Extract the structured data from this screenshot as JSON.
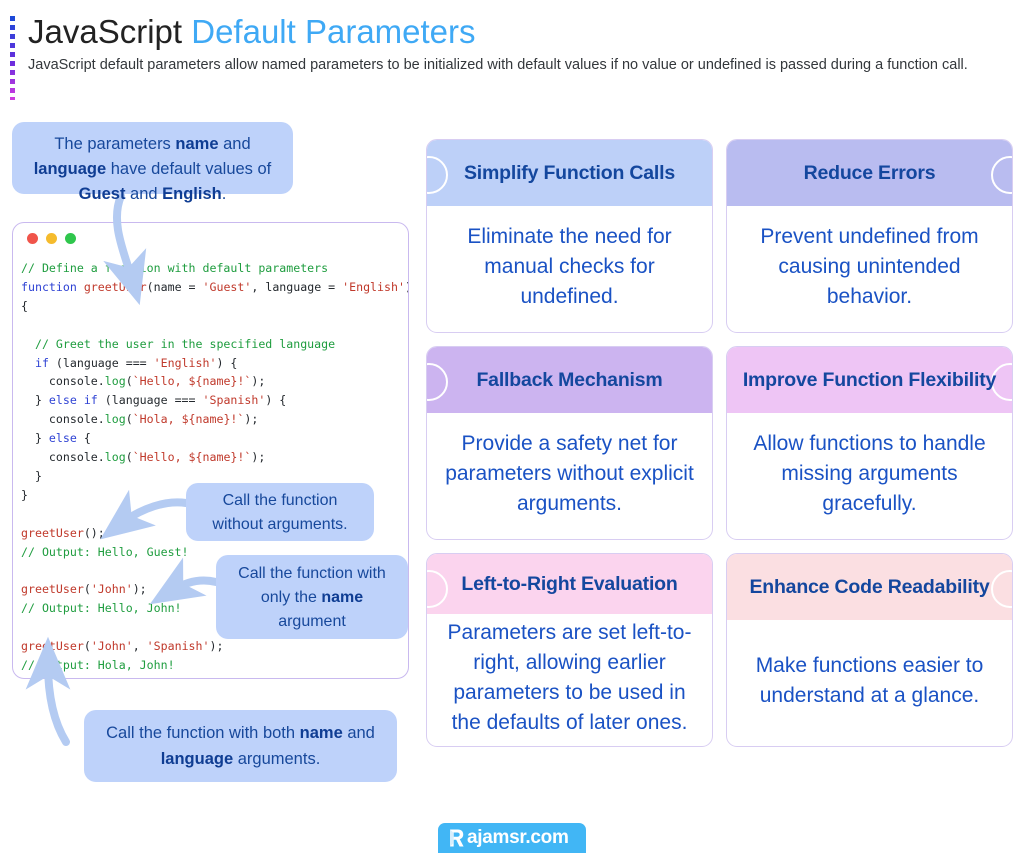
{
  "header": {
    "title_plain": "JavaScript",
    "title_accent": "Default Parameters",
    "subtitle": "JavaScript default parameters allow named parameters to be initialized with default values if no value or undefined is passed during a function call."
  },
  "callouts": {
    "top": {
      "segments": [
        {
          "text": "The parameters ",
          "bold": false
        },
        {
          "text": "name",
          "bold": true
        },
        {
          "text": " and ",
          "bold": false
        },
        {
          "text": "language",
          "bold": true
        },
        {
          "text": " have default values of ",
          "bold": false
        },
        {
          "text": "Guest",
          "bold": true
        },
        {
          "text": " and ",
          "bold": false
        },
        {
          "text": "English",
          "bold": true
        },
        {
          "text": ".",
          "bold": false
        }
      ]
    },
    "no_args": {
      "segments": [
        {
          "text": "Call the function without arguments.",
          "bold": false
        }
      ]
    },
    "name_arg": {
      "segments": [
        {
          "text": "Call the function with only the ",
          "bold": false
        },
        {
          "text": "name",
          "bold": true
        },
        {
          "text": " argument",
          "bold": false
        }
      ]
    },
    "both_args": {
      "segments": [
        {
          "text": "Call the function with both ",
          "bold": false
        },
        {
          "text": "name",
          "bold": true
        },
        {
          "text": " and ",
          "bold": false
        },
        {
          "text": "language",
          "bold": true
        },
        {
          "text": " arguments.",
          "bold": false
        }
      ]
    }
  },
  "code_window": {
    "dots": [
      "red",
      "yellow",
      "green"
    ],
    "lines": [
      [
        {
          "t": "// Define a function with default parameters",
          "c": "cm"
        }
      ],
      [
        {
          "t": "function ",
          "c": "kw"
        },
        {
          "t": "greetUser",
          "c": "fn"
        },
        {
          "t": "(name = ",
          "c": "pl"
        },
        {
          "t": "'Guest'",
          "c": "st"
        },
        {
          "t": ", language = ",
          "c": "pl"
        },
        {
          "t": "'English'",
          "c": "st"
        },
        {
          "t": ")",
          "c": "pl"
        }
      ],
      [
        {
          "t": "{",
          "c": "pl"
        }
      ],
      [
        {
          "t": "",
          "c": "pl"
        }
      ],
      [
        {
          "t": "  // Greet the user in the specified language",
          "c": "cm"
        }
      ],
      [
        {
          "t": "  ",
          "c": "pl"
        },
        {
          "t": "if",
          "c": "kw"
        },
        {
          "t": " (language === ",
          "c": "pl"
        },
        {
          "t": "'English'",
          "c": "st"
        },
        {
          "t": ") {",
          "c": "pl"
        }
      ],
      [
        {
          "t": "    console.",
          "c": "pl"
        },
        {
          "t": "log",
          "c": "mth"
        },
        {
          "t": "(",
          "c": "pl"
        },
        {
          "t": "`Hello, ${name}!`",
          "c": "st"
        },
        {
          "t": ");",
          "c": "pl"
        }
      ],
      [
        {
          "t": "  } ",
          "c": "pl"
        },
        {
          "t": "else if",
          "c": "kw"
        },
        {
          "t": " (language === ",
          "c": "pl"
        },
        {
          "t": "'Spanish'",
          "c": "st"
        },
        {
          "t": ") {",
          "c": "pl"
        }
      ],
      [
        {
          "t": "    console.",
          "c": "pl"
        },
        {
          "t": "log",
          "c": "mth"
        },
        {
          "t": "(",
          "c": "pl"
        },
        {
          "t": "`Hola, ${name}!`",
          "c": "st"
        },
        {
          "t": ");",
          "c": "pl"
        }
      ],
      [
        {
          "t": "  } ",
          "c": "pl"
        },
        {
          "t": "else",
          "c": "kw"
        },
        {
          "t": " {",
          "c": "pl"
        }
      ],
      [
        {
          "t": "    console.",
          "c": "pl"
        },
        {
          "t": "log",
          "c": "mth"
        },
        {
          "t": "(",
          "c": "pl"
        },
        {
          "t": "`Hello, ${name}!`",
          "c": "st"
        },
        {
          "t": ");",
          "c": "pl"
        }
      ],
      [
        {
          "t": "  }",
          "c": "pl"
        }
      ],
      [
        {
          "t": "}",
          "c": "pl"
        }
      ],
      [
        {
          "t": "",
          "c": "pl"
        }
      ],
      [
        {
          "t": "greetUser",
          "c": "fn"
        },
        {
          "t": "();",
          "c": "pl"
        }
      ],
      [
        {
          "t": "// Output: Hello, Guest!",
          "c": "cm"
        }
      ],
      [
        {
          "t": "",
          "c": "pl"
        }
      ],
      [
        {
          "t": "greetUser",
          "c": "fn"
        },
        {
          "t": "(",
          "c": "pl"
        },
        {
          "t": "'John'",
          "c": "st"
        },
        {
          "t": ");",
          "c": "pl"
        }
      ],
      [
        {
          "t": "// Output: Hello, John!",
          "c": "cm"
        }
      ],
      [
        {
          "t": "",
          "c": "pl"
        }
      ],
      [
        {
          "t": "greetUser",
          "c": "fn"
        },
        {
          "t": "(",
          "c": "pl"
        },
        {
          "t": "'John'",
          "c": "st"
        },
        {
          "t": ", ",
          "c": "pl"
        },
        {
          "t": "'Spanish'",
          "c": "st"
        },
        {
          "t": ");",
          "c": "pl"
        }
      ],
      [
        {
          "t": "// Output: Hola, John!",
          "c": "cm"
        }
      ]
    ]
  },
  "cards": [
    {
      "title": "Simplify Function Calls",
      "text": "Eliminate the need for manual checks for undefined.",
      "header_color": "#bdd0f8",
      "circle_side": "left"
    },
    {
      "title": "Reduce Errors",
      "text": "Prevent undefined from causing unintended behavior.",
      "header_color": "#b9bcf0",
      "circle_side": "right"
    },
    {
      "title": "Fallback Mechanism",
      "text": "Provide a safety net for parameters without explicit arguments.",
      "header_color": "#ccb4f0",
      "circle_side": "left"
    },
    {
      "title": "Improve Function Flexibility",
      "text": "Allow functions to handle missing arguments gracefully.",
      "header_color": "#eec5f5",
      "circle_side": "right"
    },
    {
      "title": "Left-to-Right Evaluation",
      "text": "Parameters are set left-to-right, allowing earlier parameters to be used in the defaults of later ones.",
      "header_color": "#fbd4ee",
      "circle_side": "left"
    },
    {
      "title": "Enhance Code Readability",
      "text": "Make functions easier to understand at a glance.",
      "header_color": "#fbdfe2",
      "circle_side": "right"
    }
  ],
  "footer": {
    "brand": "ajamsr.com",
    "badge_color": "#41b6f5"
  }
}
